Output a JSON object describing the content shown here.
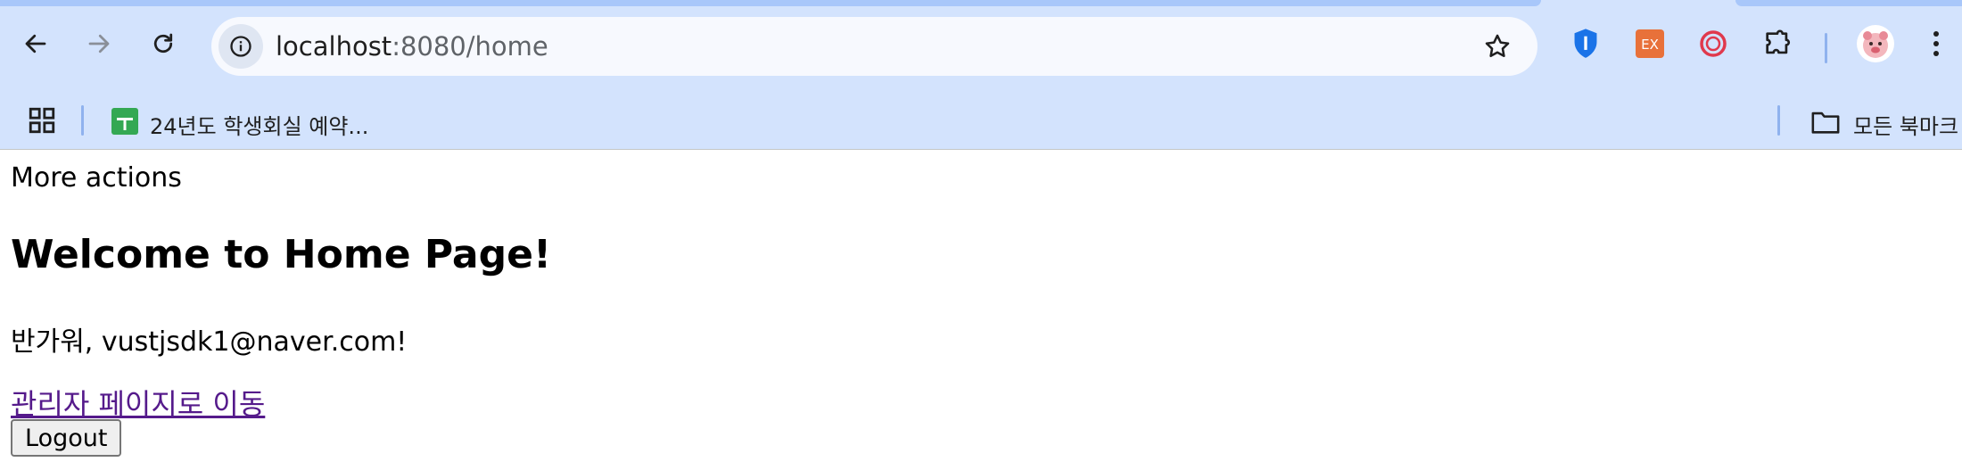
{
  "browser": {
    "url_host": "localhost",
    "url_rest": ":8080/home",
    "icons": {
      "back": "arrow-left-icon",
      "forward": "arrow-right-icon",
      "reload": "reload-icon",
      "site_info": "info-icon",
      "bookmark_star": "star-icon",
      "extensions": [
        "shield-extension-icon",
        "ex-extension-icon",
        "ring-extension-icon",
        "puzzle-icon"
      ],
      "profile": "avatar-icon",
      "menu": "kebab-menu-icon"
    },
    "ext_badge_text": "EX",
    "colors": {
      "frame": "#d3e3fd",
      "accent_blue": "#1a73e8",
      "ext_orange": "#e8713a",
      "ext_red": "#e0394d",
      "bookmark_green": "#34a853"
    }
  },
  "bookmarks": {
    "apps_icon": "grid-icon",
    "item1_label": "24년도 학생회실 예약...",
    "all_bookmarks_label": "모든 북마크"
  },
  "page": {
    "more_actions": "More actions",
    "title": "Welcome to Home Page!",
    "greeting": "반가워, vustjsdk1@naver.com!",
    "admin_link": "관리자 페이지로 이동",
    "logout_label": "Logout"
  }
}
